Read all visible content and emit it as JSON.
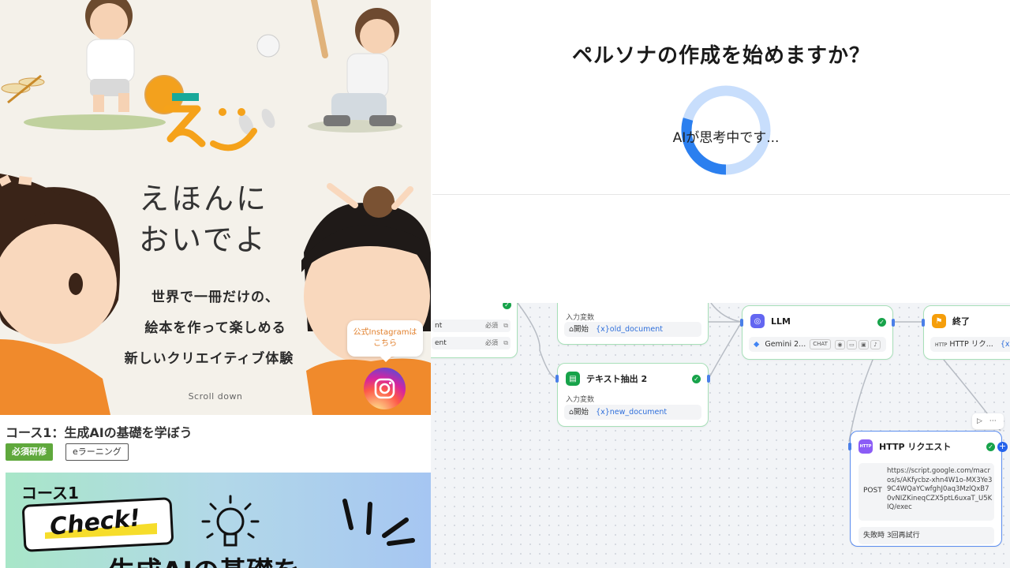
{
  "left_site": {
    "hero_title_line1": "えほんに",
    "hero_title_line2": "おいでよ",
    "tagline1": "世界で一冊だけの、",
    "tagline2": "絵本を作って楽しめる",
    "tagline3": "新しいクリエイティブ体験",
    "scroll_label": "Scroll down",
    "instagram_label_line1": "公式Instagramは",
    "instagram_label_line2": "こちら",
    "course_title": "コース1：生成AIの基礎を学ぼう",
    "tag_required": "必須研修",
    "tag_elearning": "eラーニング",
    "banner_course": "コース1",
    "banner_check": "Check!",
    "banner_bottom": "生成AIの基礎を",
    "colors": {
      "logo_orange": "#f5a21a",
      "logo_teal": "#19a99a",
      "ig_text": "#e2812e",
      "required_green": "#5fa83c"
    }
  },
  "dialog": {
    "title": "ペルソナの作成を始めますか？",
    "loading_text": "AIが思考中です...",
    "spinner_colors": {
      "track": "#c8defc",
      "arc": "#2b7fef"
    }
  },
  "workflow": {
    "left_stub_rows": [
      {
        "name": "nt",
        "badge": "必須"
      },
      {
        "name": "ent",
        "badge": "必須"
      }
    ],
    "node_extract1": {
      "sublabel": "入力変数",
      "source": "開始",
      "var": "{x}old_document"
    },
    "node_extract2": {
      "title": "テキスト抽出 2",
      "sublabel": "入力変数",
      "source": "開始",
      "var": "{x}new_document"
    },
    "node_llm": {
      "title": "LLM",
      "model": "Gemini 2...",
      "mode": "CHAT"
    },
    "node_end": {
      "title": "終了",
      "source": "HTTP リク...",
      "var": "{x}statu"
    },
    "node_http": {
      "title": "HTTP リクエスト",
      "method": "POST",
      "url": "https://script.google.com/macros/s/AKfycbz-xhn4W1o-MX3Ye39C4WQaYCwfghJ0aq3MzlQxB70vNIZKineqCZX5ptL6uxaT_U5KIQ/exec",
      "retry": "失敗時 3回再試行"
    },
    "colors": {
      "node_border": "#a8e0b9",
      "selected_border": "#5b8def",
      "edge": "#b7bcc4",
      "check": "#17a34a"
    }
  }
}
